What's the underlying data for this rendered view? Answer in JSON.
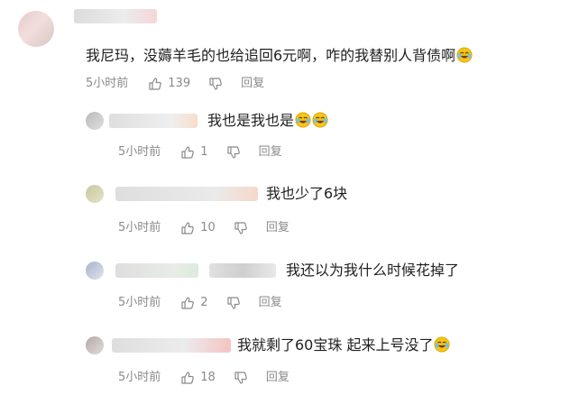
{
  "comments": [
    {
      "text": "我尼玛，没薅羊毛的也给追回6元啊，咋的我替别人背债啊",
      "emoji_count": 1,
      "time": "5小时前",
      "likes": "139",
      "reply_label": "回复"
    }
  ],
  "replies": [
    {
      "text": "我也是我也是",
      "emoji_count": 2,
      "time": "5小时前",
      "likes": "1",
      "reply_label": "回复"
    },
    {
      "text": "我也少了6块",
      "emoji_count": 0,
      "time": "5小时前",
      "likes": "10",
      "reply_label": "回复"
    },
    {
      "text": "我还以为我什么时候花掉了",
      "emoji_count": 0,
      "time": "5小时前",
      "likes": "2",
      "reply_label": "回复"
    },
    {
      "text": "我就剩了60宝珠 起来上号没了",
      "emoji_count": 1,
      "time": "5小时前",
      "likes": "18",
      "reply_label": "回复"
    }
  ],
  "colors": {
    "text": "#1f1f1f",
    "meta": "#8a8a8a",
    "emoji": "#f5c518"
  }
}
